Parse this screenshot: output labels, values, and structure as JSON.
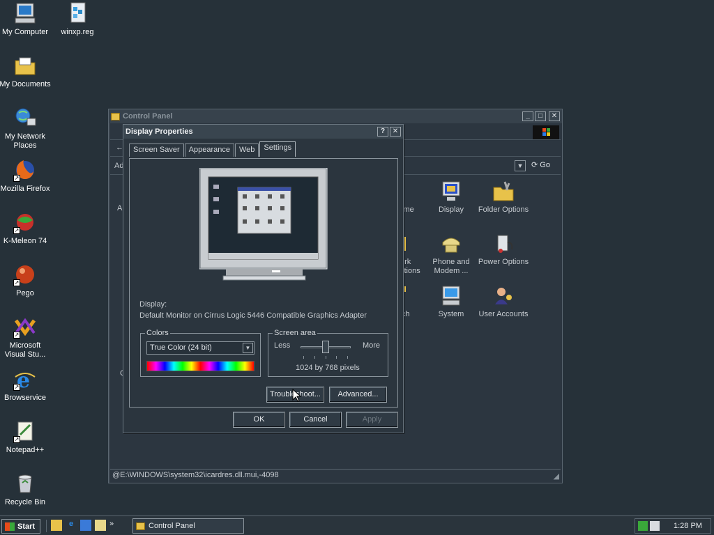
{
  "desktop": {
    "icons": [
      {
        "label": "My Computer",
        "icon": "computer-icon"
      },
      {
        "label": "winxp.reg",
        "icon": "registry-file-icon"
      },
      {
        "label": "My Documents",
        "icon": "folder-icon"
      },
      {
        "label": "My Network Places",
        "icon": "network-icon"
      },
      {
        "label": "Mozilla Firefox",
        "icon": "firefox-icon"
      },
      {
        "label": "K-Meleon 74",
        "icon": "kmeleon-icon"
      },
      {
        "label": "Pego",
        "icon": "pego-icon"
      },
      {
        "label": "Microsoft Visual Stu...",
        "icon": "visual-studio-icon"
      },
      {
        "label": "Browservice",
        "icon": "ie-icon"
      },
      {
        "label": "Notepad++",
        "icon": "notepad-icon"
      },
      {
        "label": "Recycle Bin",
        "icon": "recycle-bin-icon"
      }
    ]
  },
  "control_panel": {
    "title": "Control Panel",
    "go_label": "Go",
    "address_label": "Ad",
    "partial_left": "A",
    "partial_left2": "C",
    "items": [
      {
        "label": "ime"
      },
      {
        "label": "Display"
      },
      {
        "label": "Folder Options"
      },
      {
        "label": "ork ctions"
      },
      {
        "label": "Phone and Modem ..."
      },
      {
        "label": "Power Options"
      },
      {
        "label": "ch"
      },
      {
        "label": "System"
      },
      {
        "label": "User Accounts"
      }
    ],
    "status": "@E:\\WINDOWS\\system32\\icardres.dll.mui,-4098"
  },
  "dialog": {
    "title": "Display Properties",
    "help_btn": "?",
    "close_btn": "✕",
    "tabs": [
      "Screen Saver",
      "Appearance",
      "Web",
      "Settings"
    ],
    "display_label": "Display:",
    "display_value": "Default Monitor on Cirrus Logic 5446 Compatible Graphics Adapter",
    "colors_legend": "Colors",
    "colors_selected": "True Color (24 bit)",
    "screen_area_legend": "Screen area",
    "less": "Less",
    "more": "More",
    "resolution": "1024 by 768 pixels",
    "resolution_level": 0.5,
    "troubleshoot": "Troubleshoot...",
    "advanced": "Advanced...",
    "ok": "OK",
    "cancel": "Cancel",
    "apply": "Apply"
  },
  "taskbar": {
    "start": "Start",
    "task": "Control Panel",
    "chevron": "»",
    "time": "1:28 PM"
  },
  "colors": {
    "desktop": "#263139",
    "window": "#2c3640",
    "accent_yellow": "#e8c24a"
  }
}
